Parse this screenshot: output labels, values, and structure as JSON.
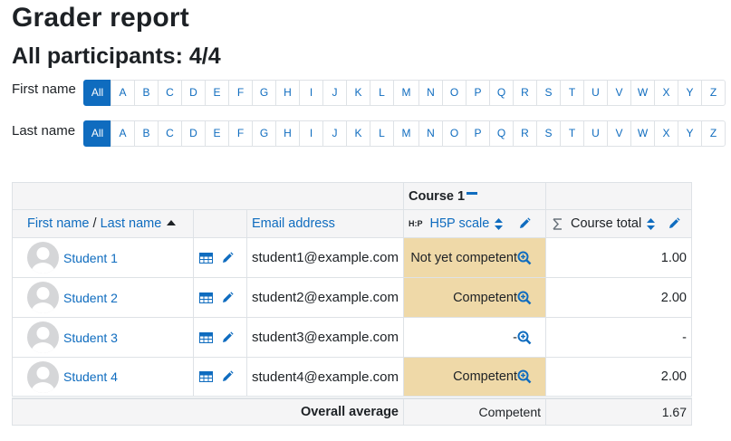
{
  "page": {
    "title": "Grader report",
    "subtitle": "All participants: 4/4"
  },
  "initials_bar": {
    "first_label": "First name",
    "last_label": "Last name",
    "all": "All",
    "letters": [
      "A",
      "B",
      "C",
      "D",
      "E",
      "F",
      "G",
      "H",
      "I",
      "J",
      "K",
      "L",
      "M",
      "N",
      "O",
      "P",
      "Q",
      "R",
      "S",
      "T",
      "U",
      "V",
      "W",
      "X",
      "Y",
      "Z"
    ]
  },
  "table": {
    "category": "Course 1",
    "headers": {
      "first_name": "First name",
      "separator": " / ",
      "last_name": "Last name",
      "email": "Email address",
      "h5p_badge": "H:P",
      "grade_item": "H5P scale",
      "course_total": "Course total"
    },
    "rows": [
      {
        "name": "Student 1",
        "email": "student1@example.com",
        "grade": "Not yet competent",
        "total": "1.00",
        "highlight": true
      },
      {
        "name": "Student 2",
        "email": "student2@example.com",
        "grade": "Competent",
        "total": "2.00",
        "highlight": true
      },
      {
        "name": "Student 3",
        "email": "student3@example.com",
        "grade": "-",
        "total": "-",
        "highlight": false
      },
      {
        "name": "Student 4",
        "email": "student4@example.com",
        "grade": "Competent",
        "total": "2.00",
        "highlight": true
      }
    ],
    "footer": {
      "label": "Overall average",
      "grade": "Competent",
      "total": "1.67"
    }
  },
  "colors": {
    "link": "#0f6cbf",
    "highlight": "#efd9a8",
    "header_bg": "#f5f5f6"
  }
}
